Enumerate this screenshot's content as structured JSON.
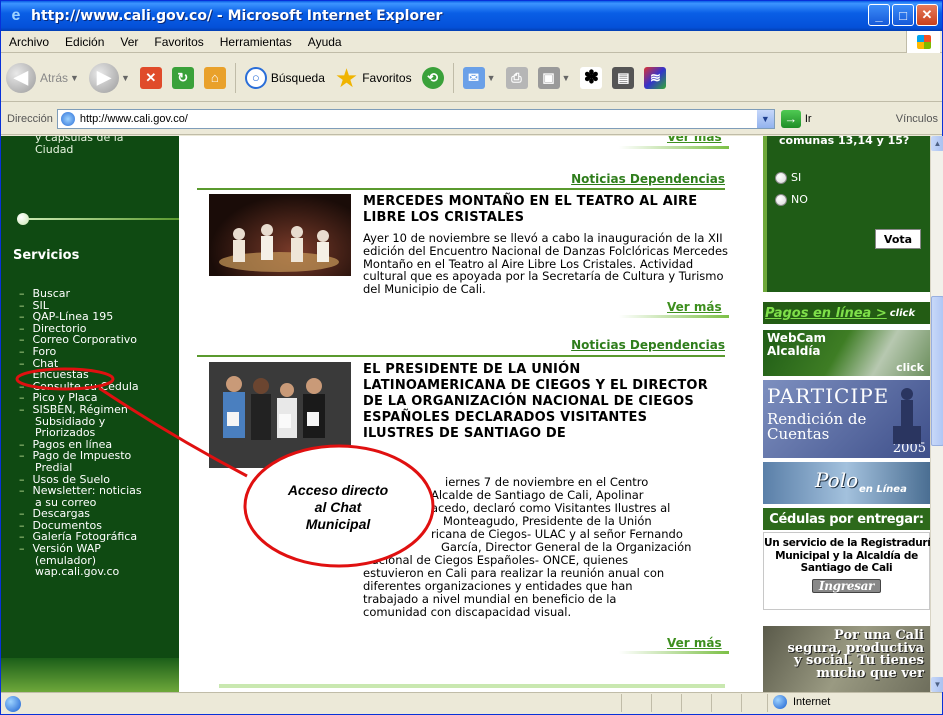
{
  "window": {
    "title": "http://www.cali.gov.co/ - Microsoft Internet Explorer"
  },
  "menu": [
    "Archivo",
    "Edición",
    "Ver",
    "Favoritos",
    "Herramientas",
    "Ayuda"
  ],
  "toolbar": {
    "back_label": "Atrás",
    "search_label": "Búsqueda",
    "favorites_label": "Favoritos"
  },
  "address": {
    "label": "Dirección",
    "url": "http://www.cali.gov.co/",
    "go_label": "Ir",
    "links_label": "Vínculos"
  },
  "sidebar": {
    "top_text": "y cápsulas de la\nCiudad",
    "services_title": "Servicios",
    "items": [
      {
        "label": "Buscar"
      },
      {
        "label": "SIL"
      },
      {
        "label": "QAP-Línea 195"
      },
      {
        "label": "Directorio"
      },
      {
        "label": "Correo Corporativo"
      },
      {
        "label": "Foro"
      },
      {
        "label": "Chat"
      },
      {
        "label": "Encuestas"
      },
      {
        "label": "Consulte su Cédula"
      },
      {
        "label": "Pico y Placa"
      },
      {
        "label": "SISBEN, Régimen"
      },
      {
        "label": "Subsidiado y",
        "cont": true
      },
      {
        "label": "Priorizados",
        "cont": true
      },
      {
        "label": "Pagos en línea"
      },
      {
        "label": "Pago de Impuesto"
      },
      {
        "label": "Predial",
        "cont": true
      },
      {
        "label": "Usos de Suelo"
      },
      {
        "label": "Newsletter: noticias"
      },
      {
        "label": "a su correo",
        "cont": true
      },
      {
        "label": "Descargas"
      },
      {
        "label": "Documentos"
      },
      {
        "label": "Galería Fotográfica"
      },
      {
        "label": "Versión WAP"
      },
      {
        "label": "(emulador)",
        "cont": true
      },
      {
        "label": "wap.cali.gov.co",
        "cont": true
      }
    ]
  },
  "news": {
    "ver_mas": "Ver más",
    "items": [
      {
        "section": "Noticias Dependencias",
        "headline": "MERCEDES MONTAÑO EN EL TEATRO AL AIRE LIBRE LOS CRISTALES",
        "body": "Ayer 10 de noviembre se llevó a cabo la inauguración de la XII edición del Encuentro Nacional de Danzas Folclóricas Mercedes Montaño en el Teatro al Aire Libre Los Cristales. Actividad cultural que es apoyada por la Secretaría de Cultura y Turismo del Municipio de Cali."
      },
      {
        "section": "Noticias Dependencias",
        "headline": "EL PRESIDENTE DE LA UNIÓN LATINOAMERICANA DE CIEGOS Y EL DIRECTOR DE LA ORGANIZACIÓN NACIONAL DE CIEGOS ESPAÑOLES DECLARADOS VISITANTES ILUSTRES DE SANTIAGO DE",
        "body_lines": [
          "iernes 7 de noviembre en el Centro",
          "Alcalde de Santiago de Cali, Apolinar",
          "acedo, declaró como Visitantes Ilustres al",
          "Monteagudo, Presidente de la Unión",
          "ricana de Ciegos- ULAC y al señor Fernando",
          "García, Director General de la Organización",
          "Nacional de Ciegos Españoles- ONCE, quienes",
          "estuvieron en Cali para realizar la reunión anual con",
          "diferentes organizaciones y entidades que han",
          "trabajado a nivel mundial en beneficio de la",
          "comunidad con discapacidad visual."
        ]
      }
    ]
  },
  "poll": {
    "question_tail": "comunas 13,14 y 15?",
    "options": [
      "SI",
      "NO"
    ],
    "vote_label": "Vota"
  },
  "banners": {
    "pagos": "Pagos en línea >",
    "pagos_click": "click",
    "webcam": "WebCam\nAlcaldía",
    "webcam_click": "click",
    "participe": "PARTICIPE",
    "rendicion": "Rendición de\nCuentas",
    "year": "2005",
    "polo": "Polo",
    "polo_sub": "en Línea",
    "cedulas": "Cédulas por entregar:",
    "registraduria": "Un servicio de la Registraduría\nMunicipal y la Alcaldía de\nSantiago de Cali",
    "ingresar": "Ingresar",
    "cali_slogan": "Por una Cali\nsegura, productiva\ny social. Tu tienes\nmucho que ver"
  },
  "annotation": {
    "text": "Acceso directo\nal Chat\nMunicipal",
    "color": "#e01010"
  },
  "status": {
    "zone": "Internet"
  }
}
